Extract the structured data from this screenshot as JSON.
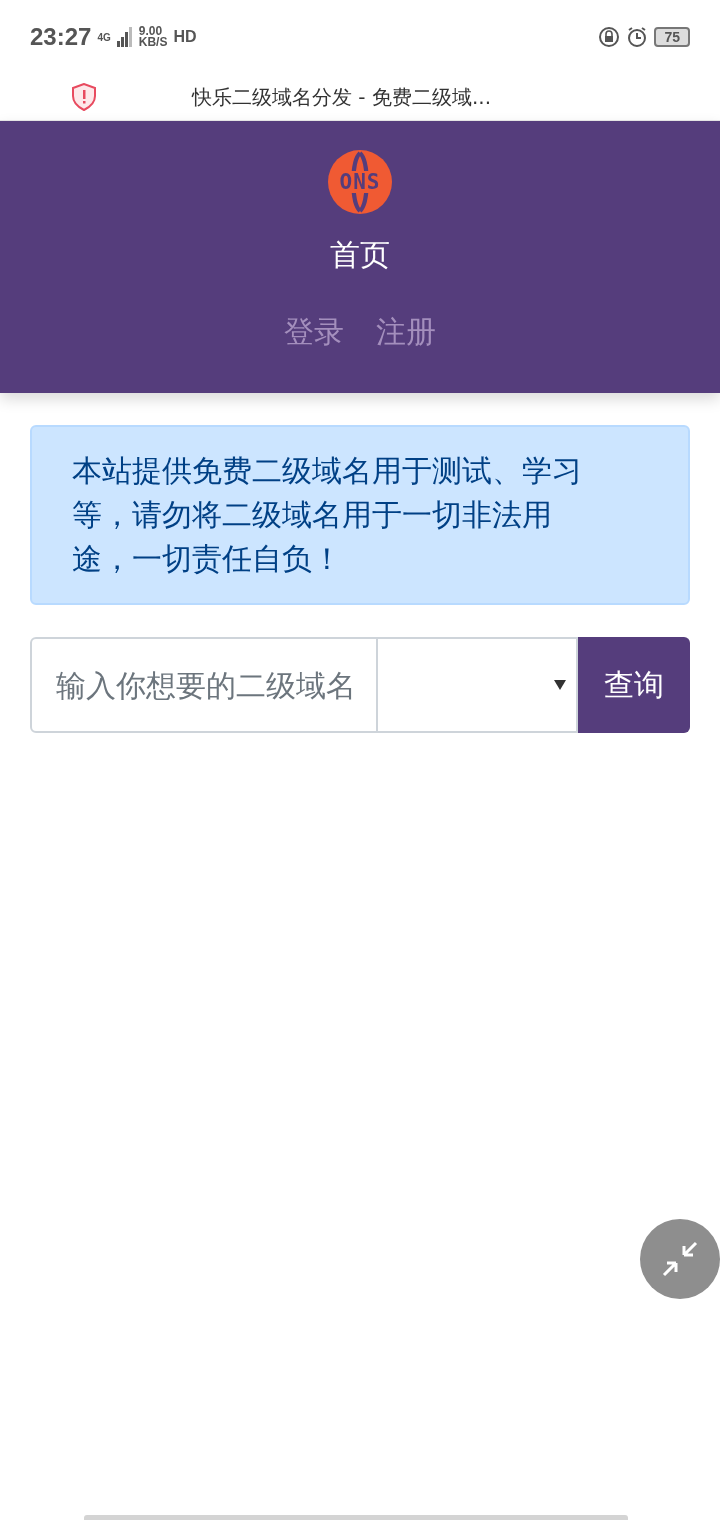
{
  "status_bar": {
    "time": "23:27",
    "network": "4G",
    "speed_value": "9.00",
    "speed_unit": "KB/S",
    "hd": "HD",
    "battery": "75"
  },
  "browser": {
    "title": "快乐二级域名分发 - 免费二级域..."
  },
  "header": {
    "logo_text": "ONS",
    "title": "首页",
    "links": [
      {
        "label": "登录"
      },
      {
        "label": "注册"
      }
    ]
  },
  "notice": "本站提供免费二级域名用于测试、学习等，请勿将二级域名用于一切非法用途，一切责任自负！",
  "search": {
    "placeholder": "输入你想要的二级域名",
    "button": "查询"
  }
}
